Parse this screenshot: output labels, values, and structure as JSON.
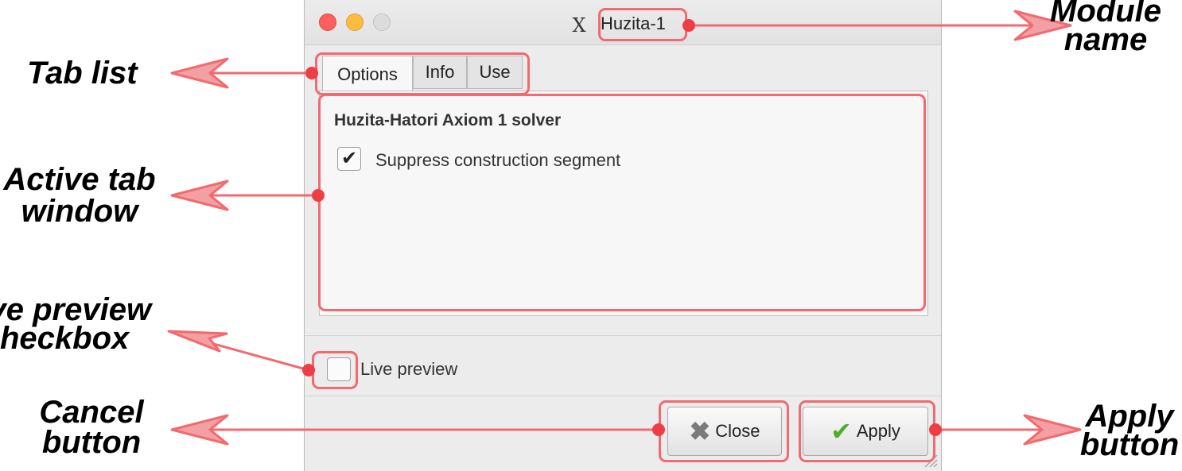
{
  "window": {
    "title": "Huzita-1",
    "title_icon": "X",
    "tabs": [
      {
        "label": "Options",
        "active": true
      },
      {
        "label": "Info",
        "active": false
      },
      {
        "label": "Use",
        "active": false
      }
    ],
    "panel_heading": "Huzita-Hatori Axiom 1 solver",
    "suppress_checkbox": {
      "label": "Suppress construction segment",
      "checked": true
    },
    "live_preview_checkbox": {
      "label": "Live preview",
      "checked": false
    },
    "close_button": {
      "label": "Close",
      "icon": "close-x-icon"
    },
    "apply_button": {
      "label": "Apply",
      "icon": "checkmark-icon"
    }
  },
  "annotations": {
    "module_name": "Module\nname",
    "tab_list": "Tab list",
    "active_tab_window": "Active tab\nwindow",
    "live_preview_checkbox": "Live preview\ncheckbox",
    "cancel_button": "Cancel\nbutton",
    "apply_button": "Apply\nbutton"
  },
  "colors": {
    "annotation": "#f26a6f",
    "annotation_dot": "#ee3d45",
    "apply_check": "#4cae2b"
  }
}
